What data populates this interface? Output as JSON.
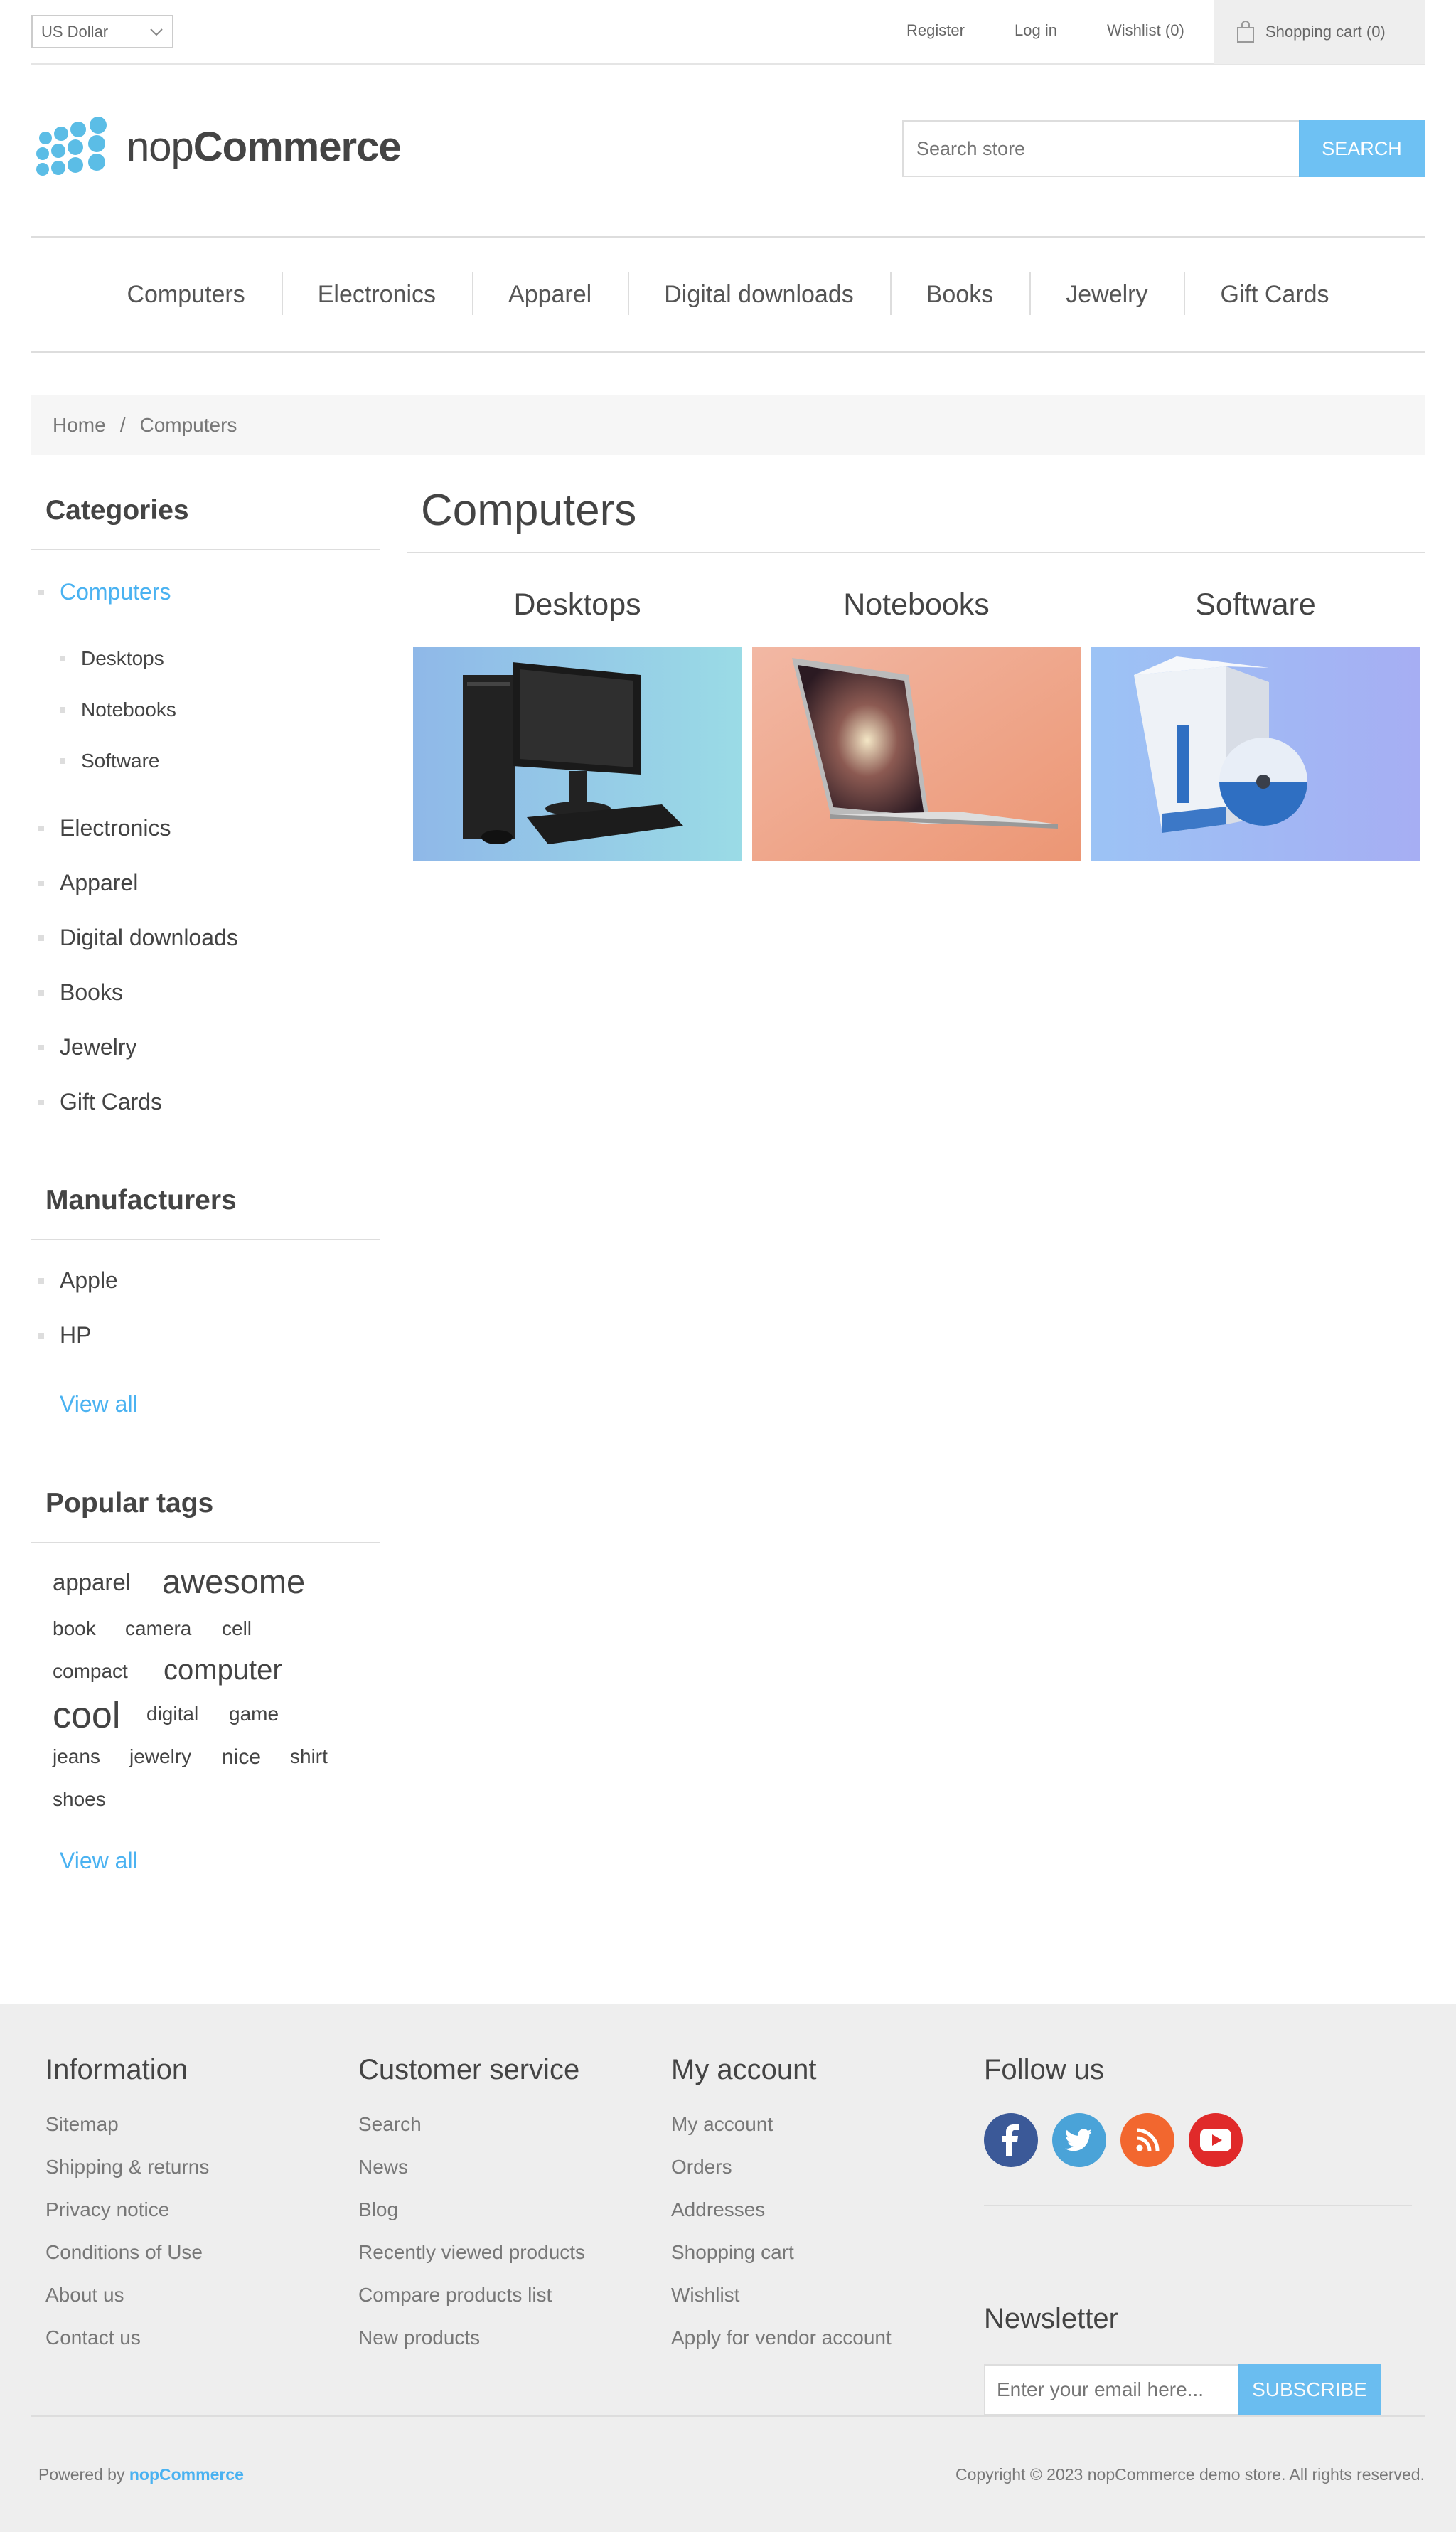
{
  "header": {
    "currency": "US Dollar",
    "links": [
      "Register",
      "Log in",
      "Wishlist (0)"
    ],
    "cart": "Shopping cart (0)"
  },
  "logo": {
    "part1": "nop",
    "part2": "Commerce"
  },
  "search": {
    "placeholder": "Search store",
    "button": "SEARCH"
  },
  "nav": [
    "Computers",
    "Electronics",
    "Apparel",
    "Digital downloads",
    "Books",
    "Jewelry",
    "Gift Cards"
  ],
  "breadcrumb": {
    "home": "Home",
    "sep": "/",
    "current": "Computers"
  },
  "categories": {
    "title": "Categories",
    "active": "Computers",
    "subitems": [
      "Desktops",
      "Notebooks",
      "Software"
    ],
    "items": [
      "Electronics",
      "Apparel",
      "Digital downloads",
      "Books",
      "Jewelry",
      "Gift Cards"
    ]
  },
  "manufacturers": {
    "title": "Manufacturers",
    "items": [
      "Apple",
      "HP"
    ],
    "view_all": "View all"
  },
  "tags": {
    "title": "Popular tags",
    "items": [
      "apparel",
      "awesome",
      "book",
      "camera",
      "cell",
      "compact",
      "computer",
      "cool",
      "digital",
      "game",
      "jeans",
      "jewelry",
      "nice",
      "shirt",
      "shoes"
    ],
    "view_all": "View all"
  },
  "main": {
    "title": "Computers",
    "subcategories": [
      "Desktops",
      "Notebooks",
      "Software"
    ]
  },
  "footer": {
    "information": {
      "title": "Information",
      "links": [
        "Sitemap",
        "Shipping & returns",
        "Privacy notice",
        "Conditions of Use",
        "About us",
        "Contact us"
      ]
    },
    "customer_service": {
      "title": "Customer service",
      "links": [
        "Search",
        "News",
        "Blog",
        "Recently viewed products",
        "Compare products list",
        "New products"
      ]
    },
    "my_account": {
      "title": "My account",
      "links": [
        "My account",
        "Orders",
        "Addresses",
        "Shopping cart",
        "Wishlist",
        "Apply for vendor account"
      ]
    },
    "follow": {
      "title": "Follow us",
      "icons": [
        "facebook-icon",
        "twitter-icon",
        "rss-icon",
        "youtube-icon"
      ]
    },
    "newsletter": {
      "title": "Newsletter",
      "placeholder": "Enter your email here...",
      "button": "SUBSCRIBE"
    },
    "powered_prefix": "Powered by",
    "powered_brand": "nopCommerce",
    "copyright": "Copyright © 2023 nopCommerce demo store. All rights reserved."
  },
  "colors": {
    "accent": "#4ab2f1",
    "footer_bg": "#eeeeee"
  }
}
